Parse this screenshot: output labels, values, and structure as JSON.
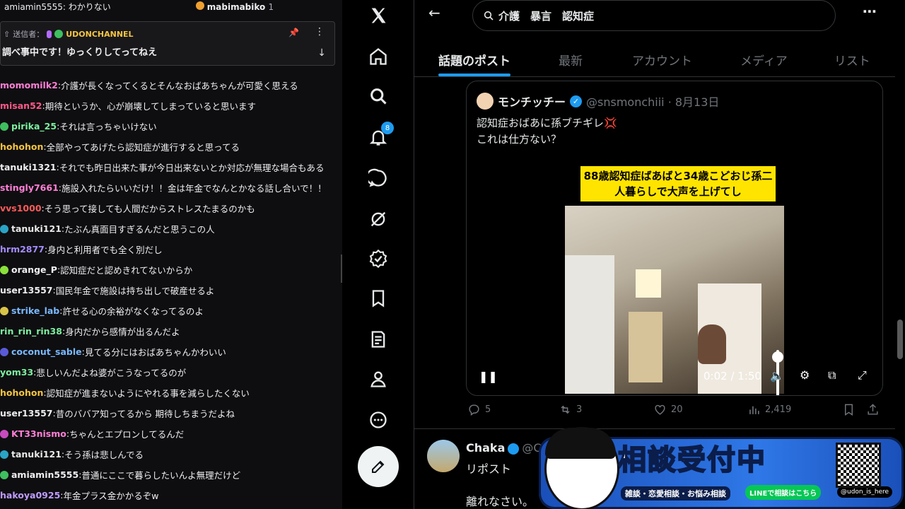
{
  "chat": {
    "top_partial": "amiamin5555: わかりない",
    "top_user": "mabimabiko",
    "top_count": "1",
    "pinned": {
      "sender_label": "送信者：",
      "sender_name": "UDONCHANNEL",
      "message": "調べ事中です！ゆっくりしてってねえ"
    },
    "messages": [
      {
        "user": "momomilk2",
        "color": "#ff7fd6",
        "badge": "",
        "text": "介護が長くなってくるとそんなおばあちゃんが可愛く思える"
      },
      {
        "user": "misan52",
        "color": "#ff5a8a",
        "badge": "",
        "text": "期待というか、心が崩壊してしまっていると思います"
      },
      {
        "user": "pirika_25",
        "color": "#7ef0a0",
        "badge": "#3fbf5f",
        "text": "それは言っちゃいけない"
      },
      {
        "user": "hohohon",
        "color": "#f5c542",
        "badge": "",
        "text": "全部やってあげたら認知症が進行すると思ってる"
      },
      {
        "user": "tanuki1321",
        "color": "#efeff1",
        "badge": "",
        "text": "それでも昨日出来た事が今日出来ないとか対応が無理な場合もある"
      },
      {
        "user": "stingly7661",
        "color": "#ff7fd6",
        "badge": "",
        "text": "施設入れたらいいだけ！！金は年金でなんとかなる話し合いで！！"
      },
      {
        "user": "vvs1000",
        "color": "#ff5a5a",
        "badge": "",
        "text": "そう思って接しても人間だからストレスたまるのかも"
      },
      {
        "user": "tanuki121",
        "color": "#e9e9e9",
        "badge": "#2ba3c4",
        "text": "たぶん真面目すぎるんだと思うこの人"
      },
      {
        "user": "hrm2877",
        "color": "#a58cff",
        "badge": "",
        "text": "身内と利用者でも全く別だし"
      },
      {
        "user": "orange_P",
        "color": "#efeff1",
        "badge": "#8be03c",
        "text": "認知症だと認めきれてないからか"
      },
      {
        "user": "user13557",
        "color": "#efeff1",
        "badge": "",
        "text": "国民年金で施設は持ち出しで破産せるよ"
      },
      {
        "user": "strike_lab",
        "color": "#7ab8ff",
        "badge": "#d9c44a",
        "text": "許せる心の余裕がなくなってるのよ"
      },
      {
        "user": "rin_rin_rin38",
        "color": "#7ef0a0",
        "badge": "",
        "text": "身内だから感情が出るんだよ"
      },
      {
        "user": "coconut_sable",
        "color": "#7ab8ff",
        "badge": "#5a5ad9",
        "text": "見てる分にはおばあちゃんかわいい"
      },
      {
        "user": "yom33",
        "color": "#7ef0a0",
        "badge": "",
        "text": "悲しいんだよね婆がこうなってるのが"
      },
      {
        "user": "hohohon",
        "color": "#f5c542",
        "badge": "",
        "text": "認知症が進まないようにやれる事を減らしたくない"
      },
      {
        "user": "user13557",
        "color": "#efeff1",
        "badge": "",
        "text": "昔のババア知ってるから 期待しちまうだよね"
      },
      {
        "user": "KT33nismo",
        "color": "#ff7fd6",
        "badge": "#c84bc0",
        "text": "ちゃんとエプロンしてるんだ"
      },
      {
        "user": "tanuki121",
        "color": "#e9e9e9",
        "badge": "#2ba3c4",
        "text": "そう孫は悲しんでる"
      },
      {
        "user": "amiamin5555",
        "color": "#efeff1",
        "badge": "#3fbf5f",
        "text": "普通にここで暮らしたいんよ無理だけど"
      },
      {
        "user": "hakoya0925",
        "color": "#c09cff",
        "badge": "",
        "text": "年金プラス金かかるぞw"
      }
    ]
  },
  "x": {
    "notif_count": "8",
    "search_query": "介護　暴言　認知症",
    "tabs": [
      "話題のポスト",
      "最新",
      "アカウント",
      "メディア",
      "リスト"
    ],
    "quote": {
      "name": "モンチッチー",
      "handle": "@snsmonchiii · 8月13日",
      "line1": "認知症おばあに孫ブチギレ",
      "flame": "💢",
      "line2": "これは仕方ない？",
      "video_caption": "88歳認知症ばあばと34歳こどおじ孫二人暮らしで大声を上げてし",
      "video_time": "0:02 / 1:50"
    },
    "actions": {
      "replies": "5",
      "reposts": "3",
      "likes": "20",
      "views": "2,419"
    },
    "reply": {
      "name": "Chaka",
      "handle": "@Ch",
      "repost": "リポスト",
      "text": "離れなさい。"
    }
  },
  "banner": {
    "title_a": "相談",
    "title_b": "受付中",
    "sub": "雑談・恋愛相談・お悩み相談",
    "line": "LINEで相談はこちら",
    "x_handle": "@udon_is_here"
  }
}
